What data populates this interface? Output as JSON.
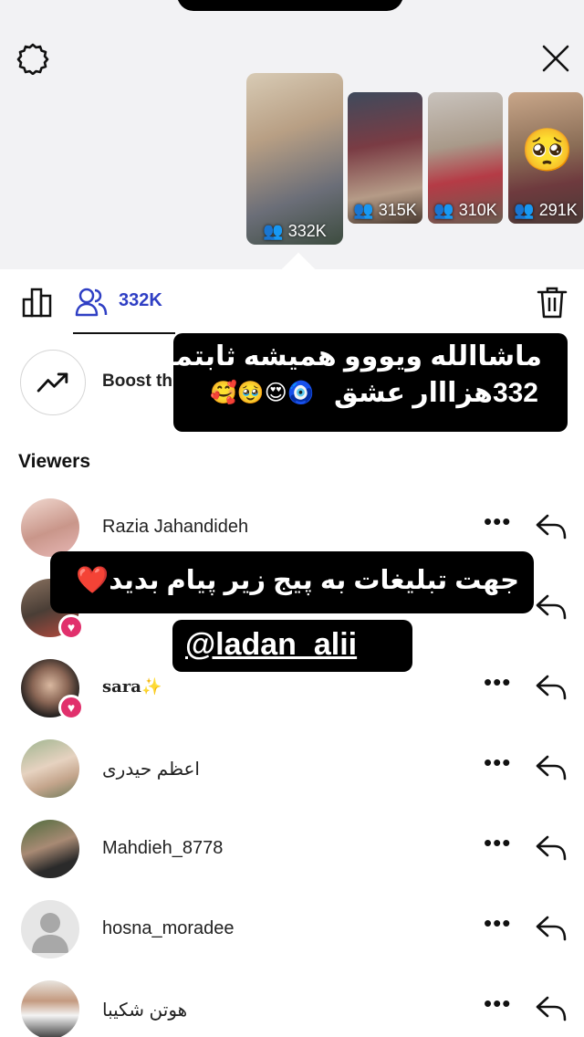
{
  "story_thumbnails": [
    {
      "count": "332K",
      "selected": true
    },
    {
      "count": "315K",
      "selected": false
    },
    {
      "count": "310K",
      "selected": false
    },
    {
      "count": "291K",
      "selected": false
    }
  ],
  "toolbar": {
    "viewer_count": "332K"
  },
  "boost": {
    "label": "Boost th"
  },
  "viewers": {
    "heading": "Viewers",
    "list": [
      {
        "name": "Razia Jahandideh",
        "liked": false
      },
      {
        "name": "",
        "liked": true
      },
      {
        "name": "sara",
        "liked": true
      },
      {
        "name": "اعظم حیدری",
        "liked": false
      },
      {
        "name": "Mahdieh_8778",
        "liked": false
      },
      {
        "name": "hosna_moradee",
        "liked": false
      },
      {
        "name": "هوتن شکیبا",
        "liked": false
      }
    ]
  },
  "overlay": {
    "caption_line1": "ماشاالله ویووو همیشه ثابتمون",
    "caption_line2": "332هزااار عشق",
    "caption_emojis": "🥰🥹😍🧿",
    "ad_text": "جهت تبلیغات به پیج زیر پیام بدید❤️",
    "handle": "@ladan_alii"
  },
  "colors": {
    "accent": "#2f3fc4",
    "heart": "#e1306c"
  },
  "icons": [
    "settings-gear-icon",
    "close-icon",
    "insights-chart-icon",
    "viewers-icon",
    "trash-icon",
    "trending-up-icon",
    "more-dots-icon",
    "reply-arrow-icon"
  ]
}
